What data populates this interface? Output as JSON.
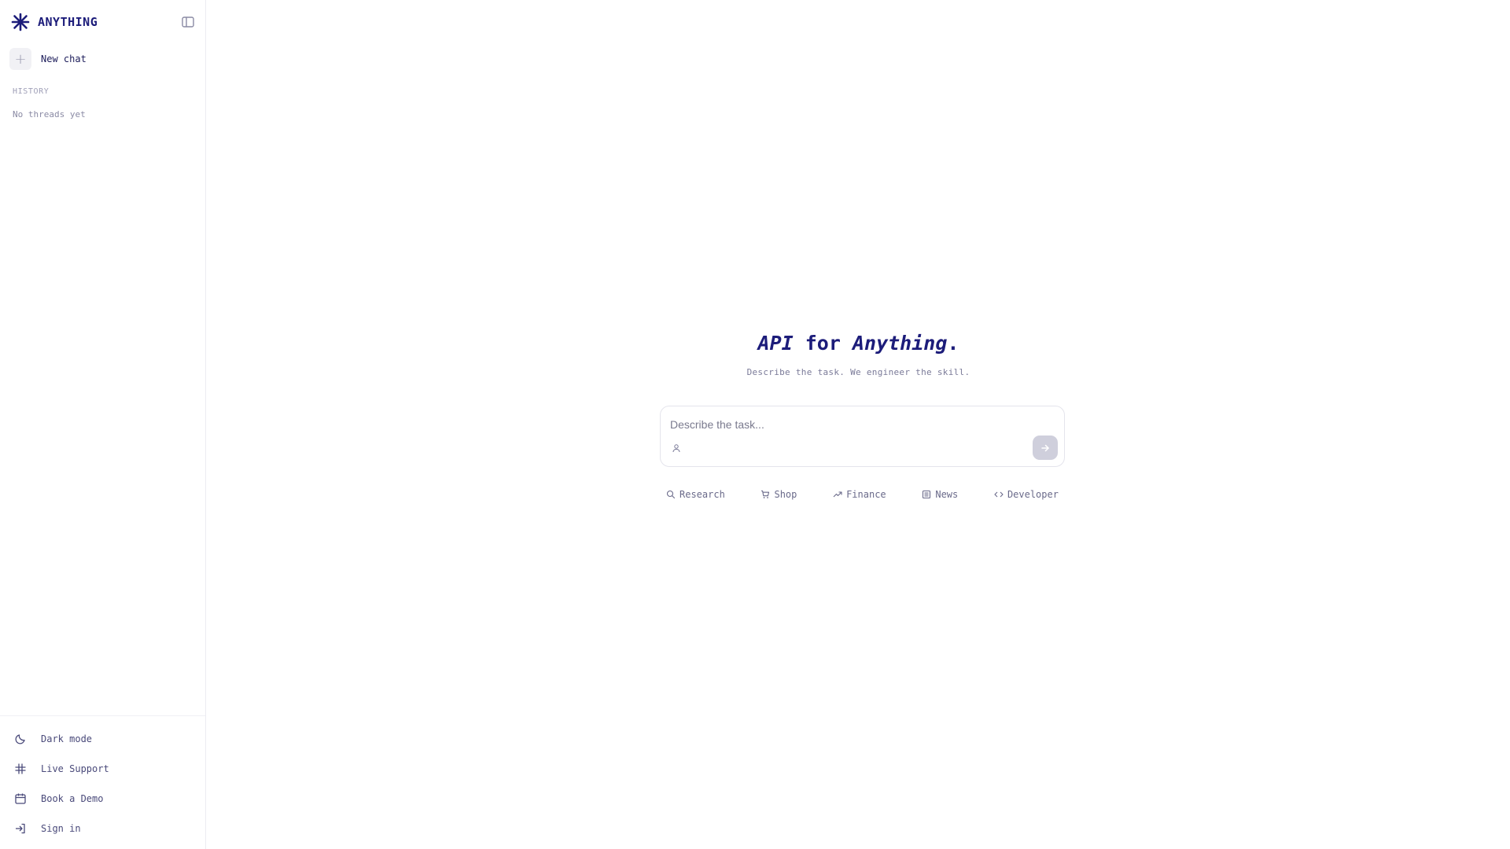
{
  "colors": {
    "brand": "#1c1c7a",
    "text_muted": "#7a7a98",
    "send_disabled": "#cfcfdc",
    "chip_bg": "#f1f1f5"
  },
  "sidebar": {
    "brand_name": "ANYTHING",
    "brand_icon": "asterisk-logo-icon",
    "collapse_icon": "sidebar-toggle-icon",
    "new_chat_label": "New chat",
    "history_label": "HISTORY",
    "history_empty": "No threads yet",
    "footer": [
      {
        "label": "Dark mode",
        "icon": "moon-icon"
      },
      {
        "label": "Live Support",
        "icon": "slack-icon"
      },
      {
        "label": "Book a Demo",
        "icon": "calendar-icon"
      },
      {
        "label": "Sign in",
        "icon": "sign-in-icon"
      }
    ]
  },
  "main": {
    "title_part1": "API",
    "title_part2": " for ",
    "title_part3": "Anything",
    "title_part4": ".",
    "subtitle": "Describe the task. We engineer the skill.",
    "input_placeholder": "Describe the task...",
    "input_value": "",
    "chips": [
      {
        "label": "Research",
        "icon": "search-icon"
      },
      {
        "label": "Shop",
        "icon": "cart-icon"
      },
      {
        "label": "Finance",
        "icon": "trend-up-icon"
      },
      {
        "label": "News",
        "icon": "newspaper-icon"
      },
      {
        "label": "Developer",
        "icon": "code-icon"
      }
    ]
  }
}
